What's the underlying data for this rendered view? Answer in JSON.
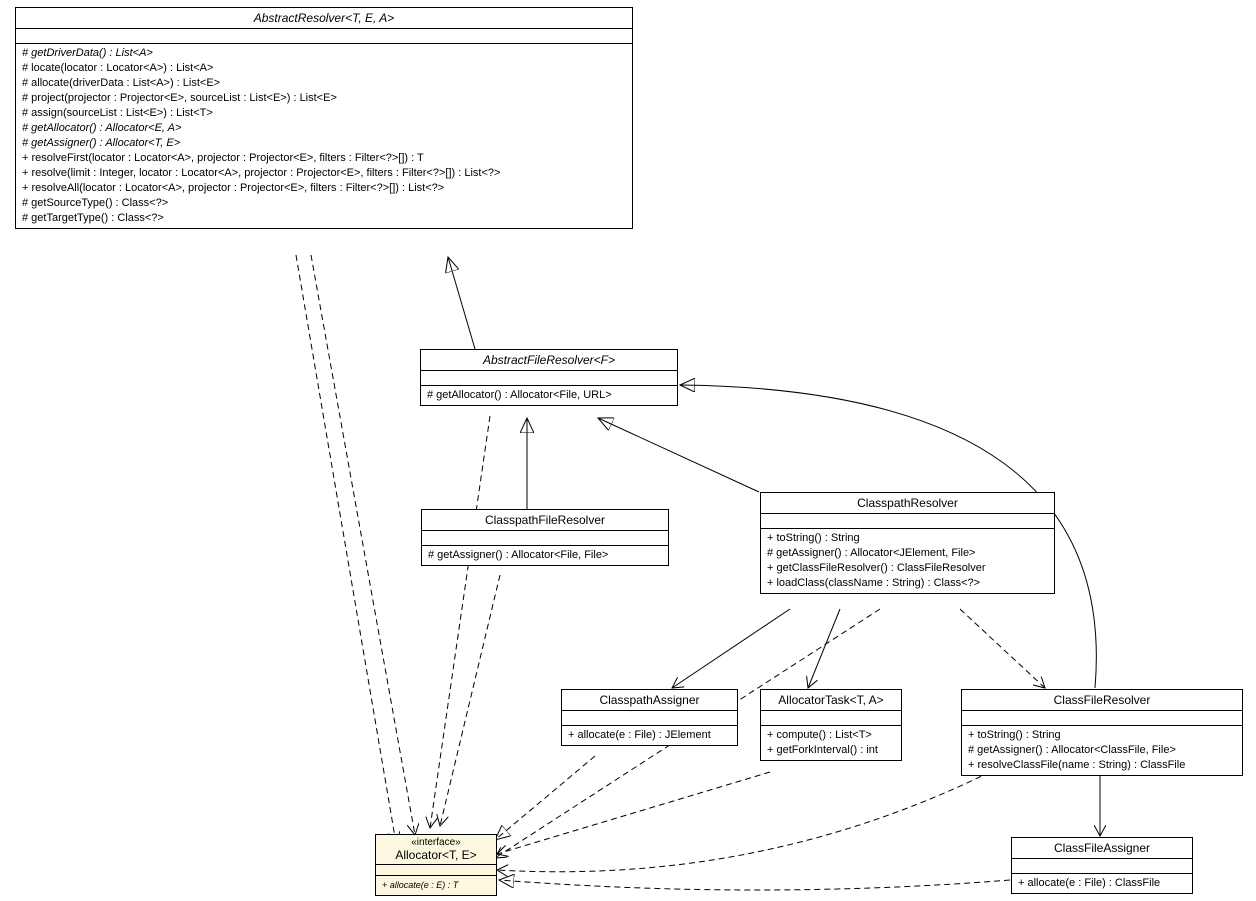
{
  "classes": {
    "abstractResolver": {
      "title": "AbstractResolver<T, E, A>",
      "ops": [
        "# getDriverData() : List<A>",
        "# locate(locator : Locator<A>) : List<A>",
        "# allocate(driverData : List<A>) : List<E>",
        "# project(projector : Projector<E>, sourceList : List<E>) : List<E>",
        "# assign(sourceList : List<E>) : List<T>",
        "# getAllocator() : Allocator<E, A>",
        "# getAssigner() : Allocator<T, E>",
        "+ resolveFirst(locator : Locator<A>, projector : Projector<E>, filters : Filter<?>[]) : T",
        "+ resolve(limit : Integer, locator : Locator<A>, projector : Projector<E>, filters : Filter<?>[]) : List<?>",
        "+ resolveAll(locator : Locator<A>, projector : Projector<E>, filters : Filter<?>[]) : List<?>",
        "# getSourceType() : Class<?>",
        "# getTargetType() : Class<?>"
      ]
    },
    "abstractFileResolver": {
      "title": "AbstractFileResolver<F>",
      "ops": [
        "# getAllocator() : Allocator<File, URL>"
      ]
    },
    "classpathFileResolver": {
      "title": "ClasspathFileResolver",
      "ops": [
        "# getAssigner() : Allocator<File, File>"
      ]
    },
    "classpathResolver": {
      "title": "ClasspathResolver",
      "ops": [
        "+ toString() : String",
        "# getAssigner() : Allocator<JElement, File>",
        "+ getClassFileResolver() : ClassFileResolver",
        "+ loadClass(className : String) : Class<?>"
      ]
    },
    "classpathAssigner": {
      "title": "ClasspathAssigner",
      "ops": [
        "+ allocate(e : File) : JElement"
      ]
    },
    "allocatorTask": {
      "title": "AllocatorTask<T, A>",
      "ops": [
        "+ compute() : List<T>",
        "+ getForkInterval() : int"
      ]
    },
    "classFileResolver": {
      "title": "ClassFileResolver",
      "ops": [
        "+ toString() : String",
        "# getAssigner() : Allocator<ClassFile, File>",
        "+ resolveClassFile(name : String) : ClassFile"
      ]
    },
    "allocator": {
      "stereo": "«interface»",
      "title": "Allocator<T, E>",
      "ops": [
        "+ allocate(e : E) : T"
      ]
    },
    "classFileAssigner": {
      "title": "ClassFileAssigner",
      "ops": [
        "+ allocate(e : File) : ClassFile"
      ]
    }
  }
}
